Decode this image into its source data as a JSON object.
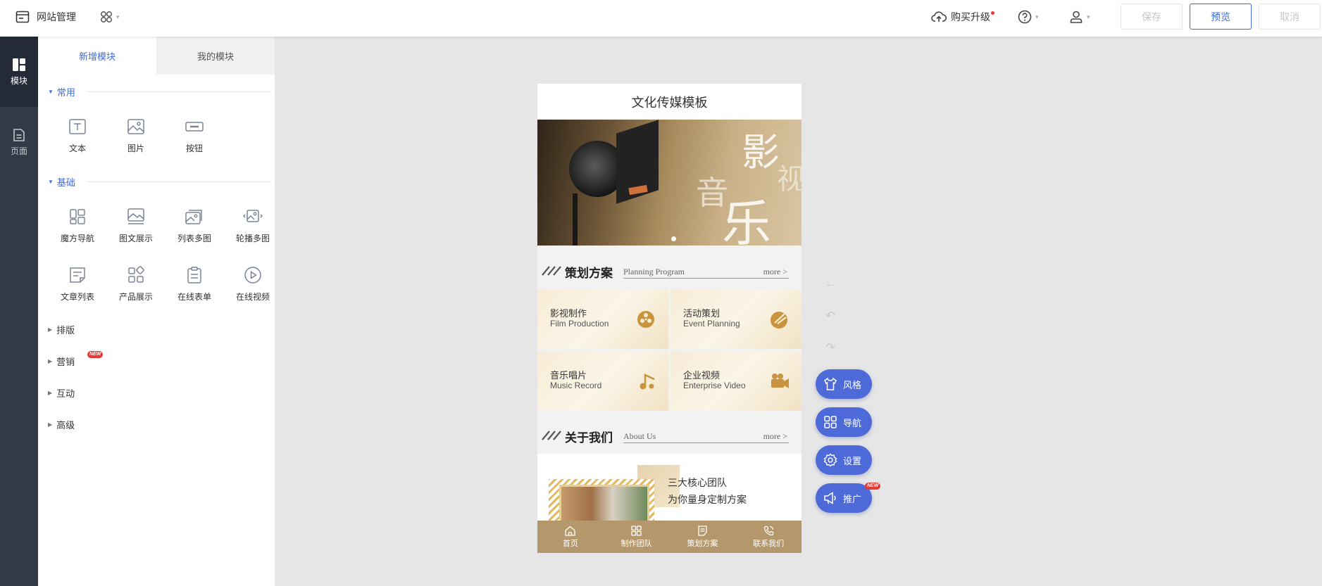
{
  "topbar": {
    "site_manage": "网站管理",
    "upgrade": "购买升级",
    "save": "保存",
    "preview": "预览",
    "cancel": "取消"
  },
  "rail": {
    "modules": "模块",
    "pages": "页面"
  },
  "panel": {
    "tabs": [
      "新增模块",
      "我的模块"
    ],
    "sections": {
      "common": {
        "title": "常用",
        "items": [
          "文本",
          "图片",
          "按钮"
        ]
      },
      "basic": {
        "title": "基础",
        "items": [
          "魔方导航",
          "图文展示",
          "列表多图",
          "轮播多图",
          "文章列表",
          "产品展示",
          "在线表单",
          "在线视频"
        ]
      },
      "collapsed": [
        "排版",
        "营销",
        "互动",
        "高级"
      ]
    },
    "new_badge": "NEW"
  },
  "phone": {
    "title": "文化传媒模板",
    "banner_text": [
      "影",
      "视",
      "音",
      "乐"
    ],
    "plan": {
      "cn": "策划方案",
      "en": "Planning Program",
      "more": "more >",
      "cells": [
        {
          "cn": "影视制作",
          "en": "Film Production"
        },
        {
          "cn": "活动策划",
          "en": "Event Planning"
        },
        {
          "cn": "音乐唱片",
          "en": "Music Record"
        },
        {
          "cn": "企业视频",
          "en": "Enterprise Video"
        }
      ]
    },
    "about": {
      "cn": "关于我们",
      "en": "About Us",
      "more": "more >",
      "line1": "三大核心团队",
      "line2": "为你量身定制方案"
    },
    "bottom_nav": [
      "首页",
      "制作团队",
      "策划方案",
      "联系我们"
    ]
  },
  "floating": {
    "style": "风格",
    "nav": "导航",
    "settings": "设置",
    "promote": "推广"
  },
  "colors": {
    "accent": "#3f6bd9",
    "rail": "#323a48",
    "fab": "#4e6ad8",
    "phone_nav": "#b4976a"
  }
}
